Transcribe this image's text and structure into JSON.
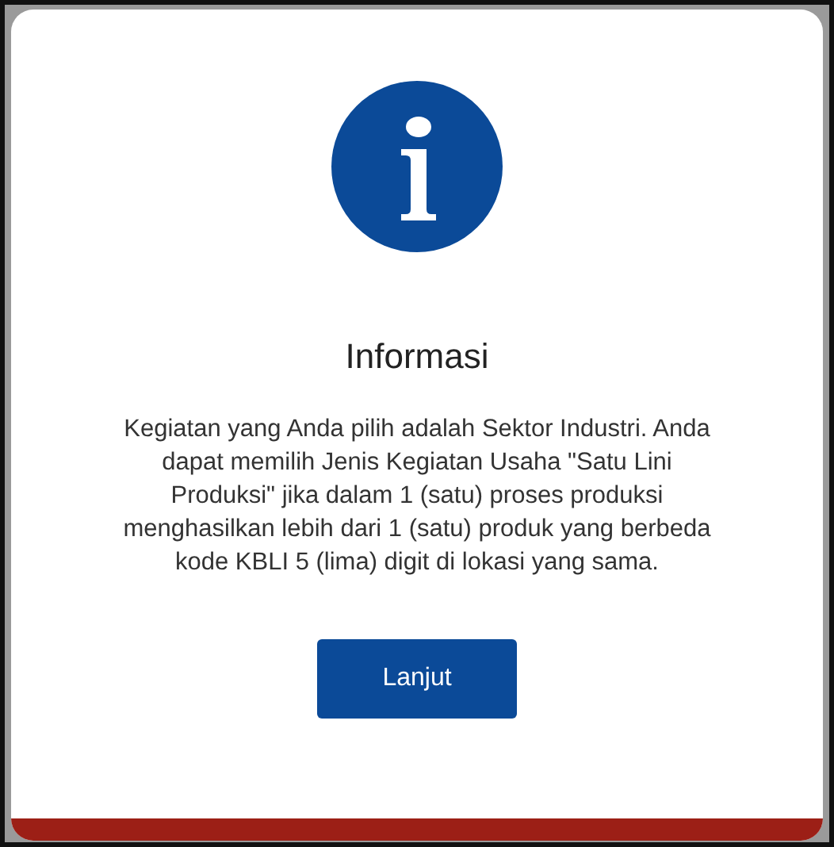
{
  "dialog": {
    "title": "Informasi",
    "message": "Kegiatan yang Anda pilih adalah Sektor Industri. Anda dapat memilih Jenis Kegiatan Usaha \"Satu Lini Produksi\" jika dalam 1 (satu) proses produksi menghasilkan lebih dari 1 (satu) produk yang berbeda kode KBLI 5 (lima) digit di lokasi yang sama.",
    "buttons": [
      "Lanjut"
    ]
  }
}
